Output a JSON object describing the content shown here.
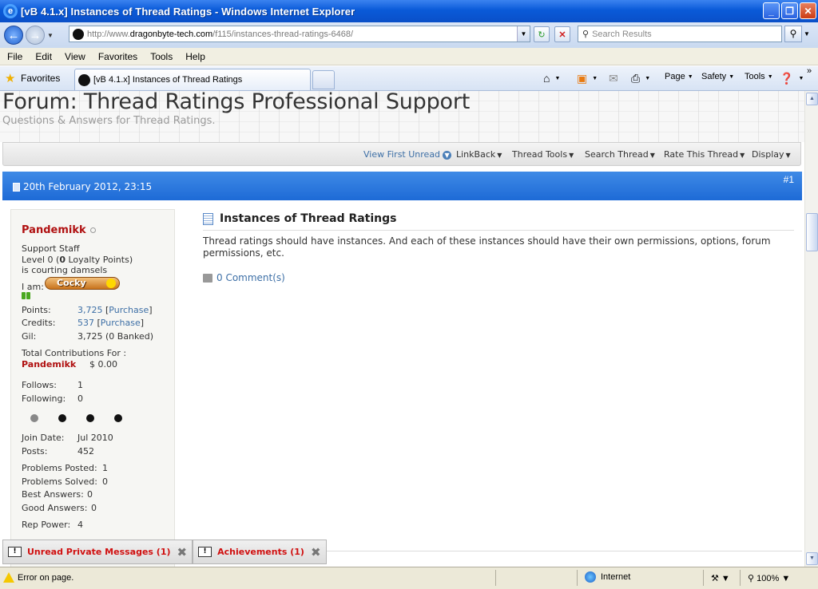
{
  "window": {
    "title": "[vB 4.1.x] Instances of Thread Ratings - Windows Internet Explorer",
    "ie_logo": "e",
    "buttons": {
      "minimize": "_",
      "maximize": "❐",
      "close": "✕"
    }
  },
  "address_bar": {
    "url_protocol": "http://www.",
    "url_domain": "dragonbyte-tech.com",
    "url_path": "/f115/instances-thread-ratings-6468/",
    "search_placeholder": "Search Results"
  },
  "menu": [
    "File",
    "Edit",
    "View",
    "Favorites",
    "Tools",
    "Help"
  ],
  "favorites_bar": {
    "favorites_label": "Favorites",
    "tab_title": "[vB 4.1.x] Instances of Thread Ratings",
    "commands": [
      "Page",
      "Safety",
      "Tools"
    ]
  },
  "forum": {
    "title": "Forum: Thread Ratings Professional Support",
    "description": "Questions & Answers for Thread Ratings."
  },
  "toolbar": {
    "view_first_unread": "View First Unread",
    "linkback": "LinkBack",
    "thread_tools": "Thread Tools",
    "search_thread": "Search Thread",
    "rate_thread": "Rate This Thread",
    "display": "Display"
  },
  "post": {
    "date": "20th February 2012, 23:15",
    "number": "#1",
    "title": "Instances of Thread Ratings",
    "body": "Thread ratings should have instances. And each of these instances should have their own permissions, options, forum permissions, etc.",
    "comments": "0 Comment(s)"
  },
  "user": {
    "name": "Pandemikk",
    "rank": "Support Staff",
    "level_prefix": "Level 0 (",
    "level_points": "0",
    "level_suffix": " Loyalty Points)",
    "status": "is courting damsels",
    "iam_label": "I am:",
    "mood": "Cocky",
    "points_label": "Points:",
    "points_value": "3,725",
    "credits_label": "Credits:",
    "credits_value": "537",
    "purchase": "Purchase",
    "gil_label": "Gil:",
    "gil_value": "3,725 (0 Banked)",
    "contrib_label": "Total Contributions For :",
    "contrib_name": "Pandemikk",
    "contrib_value": "$ 0.00",
    "follows_label": "Follows:",
    "follows_value": "1",
    "following_label": "Following:",
    "following_value": "0",
    "join_label": "Join Date:",
    "join_value": "Jul 2010",
    "posts_label": "Posts:",
    "posts_value": "452",
    "problems_posted_label": "Problems Posted:",
    "problems_posted_value": "1",
    "problems_solved_label": "Problems Solved:",
    "problems_solved_value": "0",
    "best_answers_label": "Best Answers:",
    "best_answers_value": "0",
    "good_answers_label": "Good Answers:",
    "good_answers_value": "0",
    "rep_power_label": "Rep Power:",
    "rep_power_value": "4"
  },
  "notices": [
    {
      "label": "Unread Private Messages (1)"
    },
    {
      "label": "Achievements (1)"
    }
  ],
  "status_bar": {
    "message": "Error on page.",
    "zone": "Internet",
    "zoom": "100%"
  }
}
